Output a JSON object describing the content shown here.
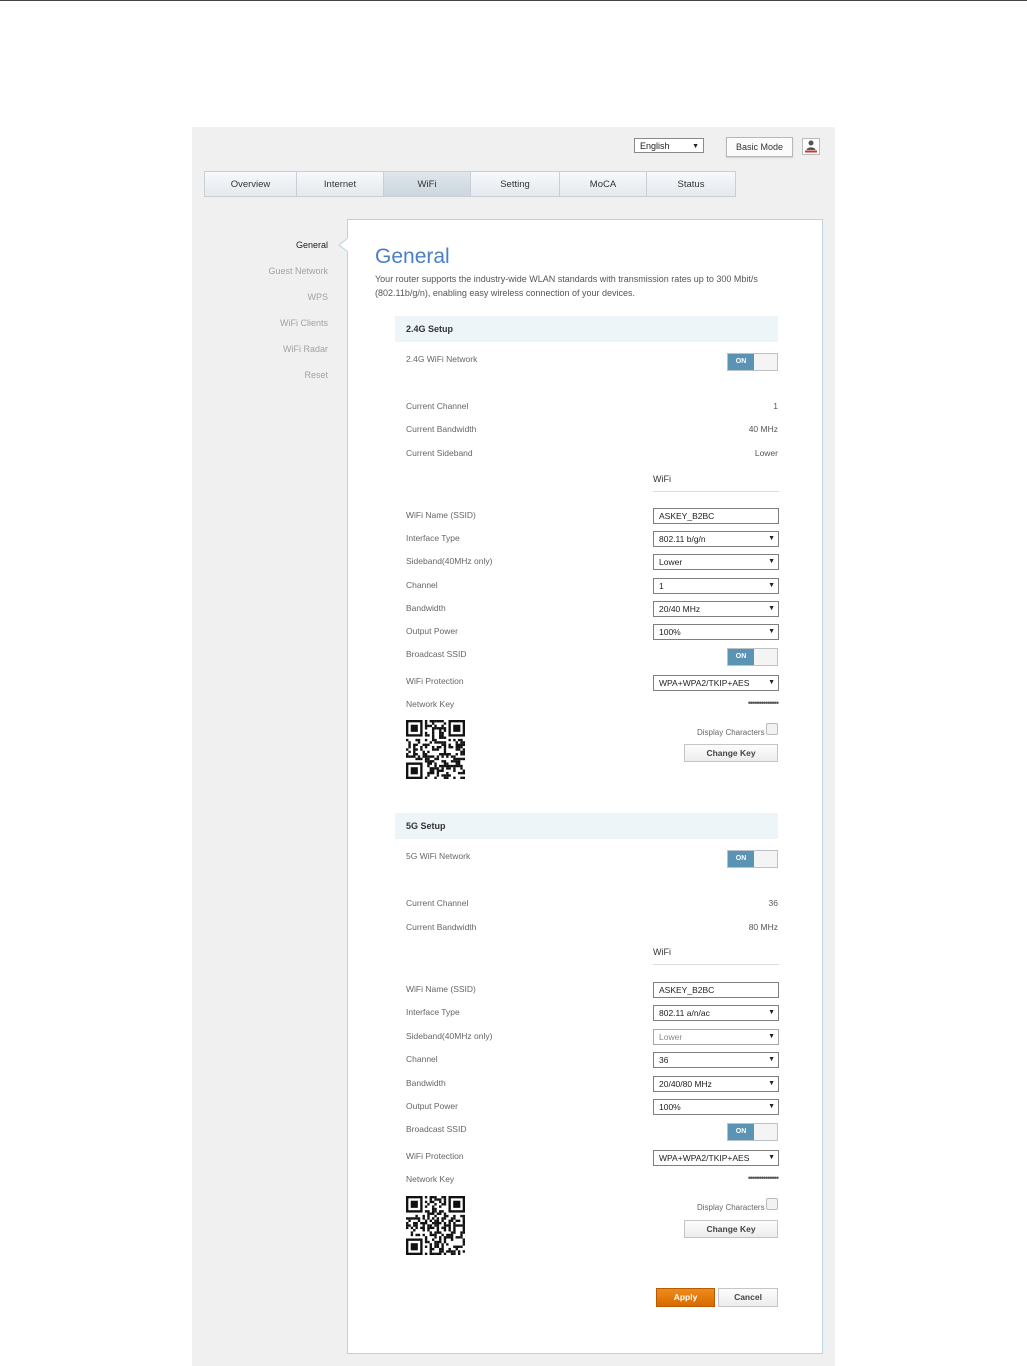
{
  "header": {
    "language": "English",
    "basic_mode_label": "Basic Mode"
  },
  "tabs": [
    {
      "label": "Overview"
    },
    {
      "label": "Internet"
    },
    {
      "label": "WiFi",
      "active": true
    },
    {
      "label": "Setting"
    },
    {
      "label": "MoCA"
    },
    {
      "label": "Status"
    }
  ],
  "sidebar": {
    "items": [
      {
        "label": "General",
        "active": true
      },
      {
        "label": "Guest Network"
      },
      {
        "label": "WPS"
      },
      {
        "label": "WiFi Clients"
      },
      {
        "label": "WiFi Radar"
      },
      {
        "label": "Reset"
      }
    ]
  },
  "page": {
    "title": "General",
    "description": "Your router supports the industry-wide WLAN standards with transmission rates up to 300 Mbit/s (802.11b/g/n), enabling easy wireless connection of your devices."
  },
  "g24": {
    "section_title": "2.4G Setup",
    "network_label": "2.4G WiFi Network",
    "network_state": "ON",
    "current_channel_label": "Current Channel",
    "current_channel": "1",
    "current_bandwidth_label": "Current Bandwidth",
    "current_bandwidth": "40 MHz",
    "current_sideband_label": "Current Sideband",
    "current_sideband": "Lower",
    "wifi_sub": "WiFi",
    "ssid_label": "WiFi Name (SSID)",
    "ssid": "ASKEY_B2BC",
    "interface_label": "Interface Type",
    "interface": "802.11 b/g/n",
    "sideband_label": "Sideband(40MHz only)",
    "sideband": "Lower",
    "channel_label": "Channel",
    "channel": "1",
    "bandwidth_label": "Bandwidth",
    "bandwidth": "20/40 MHz",
    "output_power_label": "Output Power",
    "output_power": "100%",
    "broadcast_label": "Broadcast SSID",
    "broadcast_state": "ON",
    "protection_label": "WiFi Protection",
    "protection": "WPA+WPA2/TKIP+AES",
    "network_key_label": "Network Key",
    "network_key": "••••••••••••••",
    "display_chars_label": "Display Characters",
    "change_key_label": "Change Key"
  },
  "g5": {
    "section_title": "5G Setup",
    "network_label": "5G WiFi Network",
    "network_state": "ON",
    "current_channel_label": "Current Channel",
    "current_channel": "36",
    "current_bandwidth_label": "Current Bandwidth",
    "current_bandwidth": "80 MHz",
    "wifi_sub": "WiFi",
    "ssid_label": "WiFi Name (SSID)",
    "ssid": "ASKEY_B2BC",
    "interface_label": "Interface Type",
    "interface": "802.11 a/n/ac",
    "sideband_label": "Sideband(40MHz only)",
    "sideband": "Lower",
    "channel_label": "Channel",
    "channel": "36",
    "bandwidth_label": "Bandwidth",
    "bandwidth": "20/40/80 MHz",
    "output_power_label": "Output Power",
    "output_power": "100%",
    "broadcast_label": "Broadcast SSID",
    "broadcast_state": "ON",
    "protection_label": "WiFi Protection",
    "protection": "WPA+WPA2/TKIP+AES",
    "network_key_label": "Network Key",
    "network_key": "••••••••••••••",
    "display_chars_label": "Display Characters",
    "change_key_label": "Change Key"
  },
  "actions": {
    "apply_label": "Apply",
    "cancel_label": "Cancel"
  },
  "colors": {
    "accent_title": "#4a7fc5",
    "toggle_on": "#5a93b3",
    "apply": "#e87c0e"
  },
  "icons": [
    "user-icon",
    "chevron-down-icon",
    "sidebar-caret-icon",
    "qr-code-icon"
  ]
}
